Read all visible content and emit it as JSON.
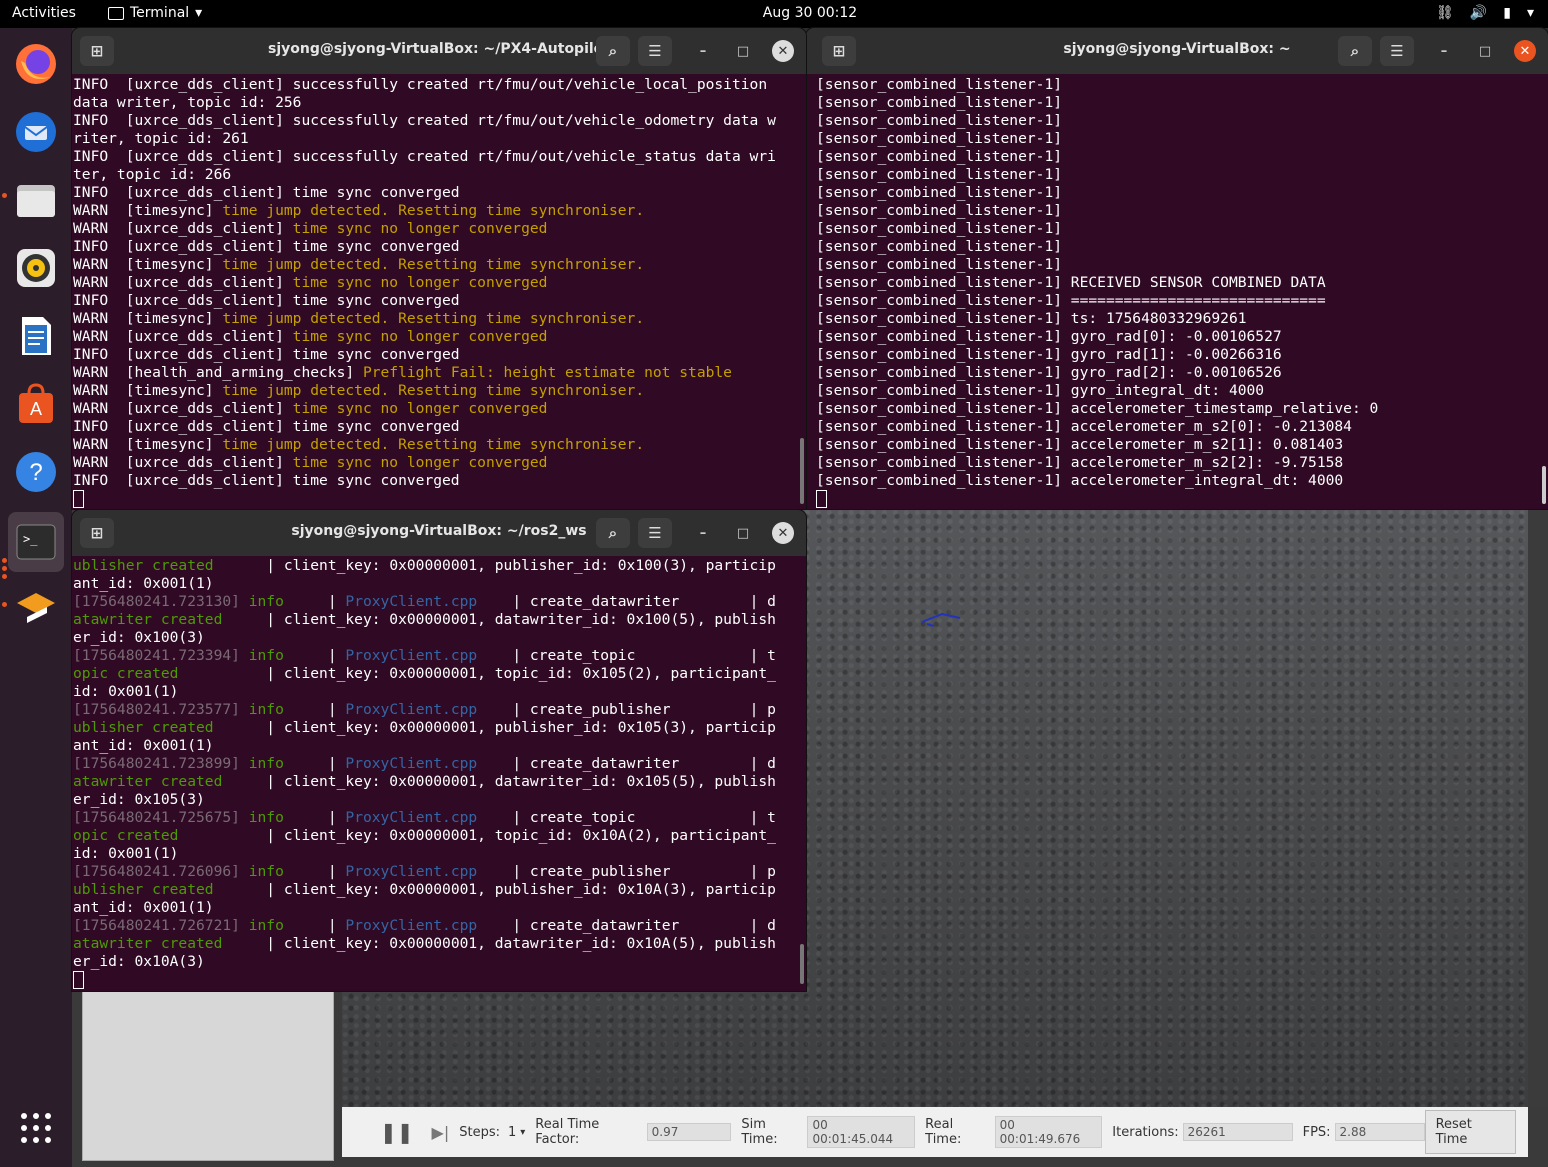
{
  "topbar": {
    "activities": "Activities",
    "app_name": "Terminal",
    "clock": "Aug 30  00:12"
  },
  "dock": [
    "firefox-icon",
    "thunderbird-icon",
    "files-icon",
    "rhythmbox-icon",
    "writer-icon",
    "software-icon",
    "help-icon",
    "terminal-icon",
    "qgroundcontrol-icon"
  ],
  "term1": {
    "title": "sjyong@sjyong-VirtualBox: ~/PX4-Autopilot",
    "lines": [
      {
        "t": "INFO  [uxrce_dds_client] successfully created rt/fmu/out/vehicle_local_position",
        "c": ""
      },
      {
        "t": "data writer, topic id: 256",
        "c": ""
      },
      {
        "t": "INFO  [uxrce_dds_client] successfully created rt/fmu/out/vehicle_odometry data w",
        "c": ""
      },
      {
        "t": "riter, topic id: 261",
        "c": ""
      },
      {
        "t": "INFO  [uxrce_dds_client] successfully created rt/fmu/out/vehicle_status data wri",
        "c": ""
      },
      {
        "t": "ter, topic id: 266",
        "c": ""
      },
      {
        "t": "INFO  [uxrce_dds_client] time sync converged",
        "c": ""
      },
      {
        "p": "WARN  [timesync] ",
        "t": "time jump detected. Resetting time synchroniser.",
        "c": "w"
      },
      {
        "p": "WARN  [uxrce_dds_client] ",
        "t": "time sync no longer converged",
        "c": "w"
      },
      {
        "t": "INFO  [uxrce_dds_client] time sync converged",
        "c": ""
      },
      {
        "p": "WARN  [timesync] ",
        "t": "time jump detected. Resetting time synchroniser.",
        "c": "w"
      },
      {
        "p": "WARN  [uxrce_dds_client] ",
        "t": "time sync no longer converged",
        "c": "w"
      },
      {
        "t": "INFO  [uxrce_dds_client] time sync converged",
        "c": ""
      },
      {
        "p": "WARN  [timesync] ",
        "t": "time jump detected. Resetting time synchroniser.",
        "c": "w"
      },
      {
        "p": "WARN  [uxrce_dds_client] ",
        "t": "time sync no longer converged",
        "c": "w"
      },
      {
        "t": "INFO  [uxrce_dds_client] time sync converged",
        "c": ""
      },
      {
        "p": "WARN  [health_and_arming_checks] ",
        "t": "Preflight Fail: height estimate not stable",
        "c": "w"
      },
      {
        "p": "WARN  [timesync] ",
        "t": "time jump detected. Resetting time synchroniser.",
        "c": "w"
      },
      {
        "p": "WARN  [uxrce_dds_client] ",
        "t": "time sync no longer converged",
        "c": "w"
      },
      {
        "t": "INFO  [uxrce_dds_client] time sync converged",
        "c": ""
      },
      {
        "p": "WARN  [timesync] ",
        "t": "time jump detected. Resetting time synchroniser.",
        "c": "w"
      },
      {
        "p": "WARN  [uxrce_dds_client] ",
        "t": "time sync no longer converged",
        "c": "w"
      },
      {
        "t": "INFO  [uxrce_dds_client] time sync converged",
        "c": ""
      }
    ]
  },
  "term2": {
    "title": "sjyong@sjyong-VirtualBox: ~",
    "prefix": "[sensor_combined_listener-1]",
    "lines": [
      "",
      "",
      "",
      "",
      "",
      "",
      "",
      "",
      "",
      "",
      "",
      " RECEIVED SENSOR COMBINED DATA",
      " =============================",
      " ts: 1756480332969261",
      " gyro_rad[0]: -0.00106527",
      " gyro_rad[1]: -0.00266316",
      " gyro_rad[2]: -0.00106526",
      " gyro_integral_dt: 4000",
      " accelerometer_timestamp_relative: 0",
      " accelerometer_m_s2[0]: -0.213084",
      " accelerometer_m_s2[1]: 0.081403",
      " accelerometer_m_s2[2]: -9.75158",
      " accelerometer_integral_dt: 4000"
    ]
  },
  "term3": {
    "title": "sjyong@sjyong-VirtualBox: ~/ros2_ws",
    "lines": [
      [
        {
          "t": "ublisher created",
          "c": "g"
        },
        {
          "t": "      | client_key: 0x00000001, publisher_id: 0x100(3), particip",
          "c": ""
        }
      ],
      [
        {
          "t": "ant_id: 0x001(1)",
          "c": ""
        }
      ],
      [
        {
          "t": "[1756480241.723130] ",
          "c": "dim"
        },
        {
          "t": "info",
          "c": "g"
        },
        {
          "t": "     | ",
          "c": ""
        },
        {
          "t": "ProxyClient.cpp",
          "c": "blue"
        },
        {
          "t": "    | create_datawriter        | d",
          "c": ""
        }
      ],
      [
        {
          "t": "atawriter created",
          "c": "g"
        },
        {
          "t": "     | client_key: 0x00000001, datawriter_id: 0x100(5), publish",
          "c": ""
        }
      ],
      [
        {
          "t": "er_id: 0x100(3)",
          "c": ""
        }
      ],
      [
        {
          "t": "[1756480241.723394] ",
          "c": "dim"
        },
        {
          "t": "info",
          "c": "g"
        },
        {
          "t": "     | ",
          "c": ""
        },
        {
          "t": "ProxyClient.cpp",
          "c": "blue"
        },
        {
          "t": "    | create_topic             | t",
          "c": ""
        }
      ],
      [
        {
          "t": "opic created",
          "c": "g"
        },
        {
          "t": "          | client_key: 0x00000001, topic_id: 0x105(2), participant_",
          "c": ""
        }
      ],
      [
        {
          "t": "id: 0x001(1)",
          "c": ""
        }
      ],
      [
        {
          "t": "[1756480241.723577] ",
          "c": "dim"
        },
        {
          "t": "info",
          "c": "g"
        },
        {
          "t": "     | ",
          "c": ""
        },
        {
          "t": "ProxyClient.cpp",
          "c": "blue"
        },
        {
          "t": "    | create_publisher         | p",
          "c": ""
        }
      ],
      [
        {
          "t": "ublisher created",
          "c": "g"
        },
        {
          "t": "      | client_key: 0x00000001, publisher_id: 0x105(3), particip",
          "c": ""
        }
      ],
      [
        {
          "t": "ant_id: 0x001(1)",
          "c": ""
        }
      ],
      [
        {
          "t": "[1756480241.723899] ",
          "c": "dim"
        },
        {
          "t": "info",
          "c": "g"
        },
        {
          "t": "     | ",
          "c": ""
        },
        {
          "t": "ProxyClient.cpp",
          "c": "blue"
        },
        {
          "t": "    | create_datawriter        | d",
          "c": ""
        }
      ],
      [
        {
          "t": "atawriter created",
          "c": "g"
        },
        {
          "t": "     | client_key: 0x00000001, datawriter_id: 0x105(5), publish",
          "c": ""
        }
      ],
      [
        {
          "t": "er_id: 0x105(3)",
          "c": ""
        }
      ],
      [
        {
          "t": "[1756480241.725675] ",
          "c": "dim"
        },
        {
          "t": "info",
          "c": "g"
        },
        {
          "t": "     | ",
          "c": ""
        },
        {
          "t": "ProxyClient.cpp",
          "c": "blue"
        },
        {
          "t": "    | create_topic             | t",
          "c": ""
        }
      ],
      [
        {
          "t": "opic created",
          "c": "g"
        },
        {
          "t": "          | client_key: 0x00000001, topic_id: 0x10A(2), participant_",
          "c": ""
        }
      ],
      [
        {
          "t": "id: 0x001(1)",
          "c": ""
        }
      ],
      [
        {
          "t": "[1756480241.726096] ",
          "c": "dim"
        },
        {
          "t": "info",
          "c": "g"
        },
        {
          "t": "     | ",
          "c": ""
        },
        {
          "t": "ProxyClient.cpp",
          "c": "blue"
        },
        {
          "t": "    | create_publisher         | p",
          "c": ""
        }
      ],
      [
        {
          "t": "ublisher created",
          "c": "g"
        },
        {
          "t": "      | client_key: 0x00000001, publisher_id: 0x10A(3), particip",
          "c": ""
        }
      ],
      [
        {
          "t": "ant_id: 0x001(1)",
          "c": ""
        }
      ],
      [
        {
          "t": "[1756480241.726721] ",
          "c": "dim"
        },
        {
          "t": "info",
          "c": "g"
        },
        {
          "t": "     | ",
          "c": ""
        },
        {
          "t": "ProxyClient.cpp",
          "c": "blue"
        },
        {
          "t": "    | create_datawriter        | d",
          "c": ""
        }
      ],
      [
        {
          "t": "atawriter created",
          "c": "g"
        },
        {
          "t": "     | client_key: 0x00000001, datawriter_id: 0x10A(5), publish",
          "c": ""
        }
      ],
      [
        {
          "t": "er_id: 0x10A(3)",
          "c": ""
        }
      ]
    ]
  },
  "gazebo": {
    "steps_label": "Steps:",
    "steps_value": "1",
    "rtf_label": "Real Time Factor:",
    "rtf_value": "0.97",
    "sim_label": "Sim Time:",
    "sim_value": "00 00:01:45.044",
    "real_label": "Real Time:",
    "real_value": "00 00:01:49.676",
    "iter_label": "Iterations:",
    "iter_value": "26261",
    "fps_label": "FPS:",
    "fps_value": "2.88",
    "reset_label": "Reset Time"
  }
}
